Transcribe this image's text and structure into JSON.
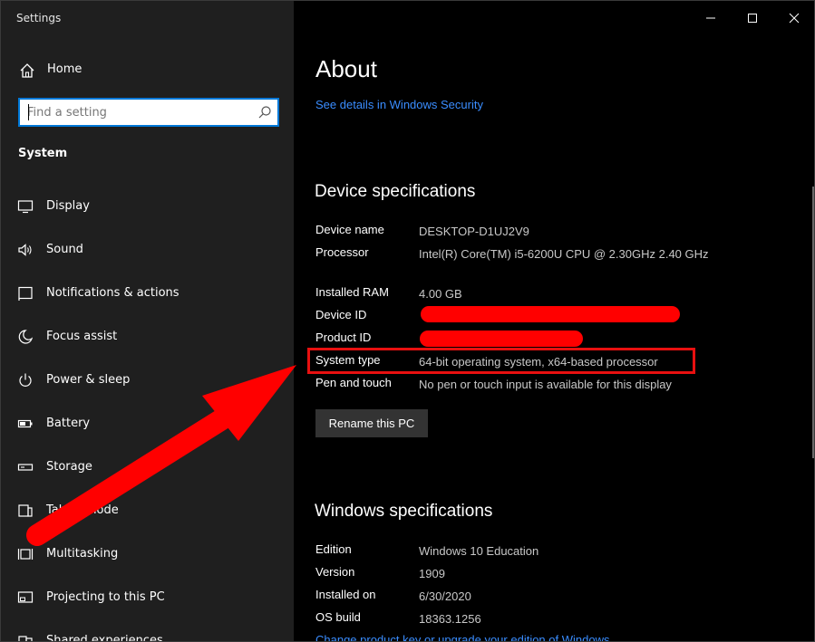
{
  "window": {
    "title": "Settings",
    "controls": {
      "minimize": "—",
      "maximize": "□",
      "close": "✕"
    }
  },
  "sidebar": {
    "home_label": "Home",
    "home_icon": "home-icon",
    "search_placeholder": "Find a setting",
    "search_icon": "search-icon",
    "section": "System",
    "items": [
      {
        "label": "Display",
        "icon": "display-icon"
      },
      {
        "label": "Sound",
        "icon": "sound-icon"
      },
      {
        "label": "Notifications & actions",
        "icon": "notifications-icon"
      },
      {
        "label": "Focus assist",
        "icon": "focus-assist-icon"
      },
      {
        "label": "Power & sleep",
        "icon": "power-icon"
      },
      {
        "label": "Battery",
        "icon": "battery-icon"
      },
      {
        "label": "Storage",
        "icon": "storage-icon"
      },
      {
        "label": "Tablet mode",
        "icon": "tablet-mode-icon"
      },
      {
        "label": "Multitasking",
        "icon": "multitasking-icon"
      },
      {
        "label": "Projecting to this PC",
        "icon": "projecting-icon"
      },
      {
        "label": "Shared experiences",
        "icon": "shared-experiences-icon"
      }
    ]
  },
  "main": {
    "title": "About",
    "security_link": "See details in Windows Security",
    "device_heading": "Device specifications",
    "device_specs": [
      {
        "key": "Device name",
        "value": "DESKTOP-D1UJ2V9"
      },
      {
        "key": "Processor",
        "value": "Intel(R) Core(TM) i5-6200U CPU @ 2.30GHz   2.40 GHz"
      },
      {
        "key": "Installed RAM",
        "value": "4.00 GB"
      },
      {
        "key": "Device ID",
        "value": ""
      },
      {
        "key": "Product ID",
        "value": ""
      },
      {
        "key": "System type",
        "value": "64-bit operating system, x64-based processor"
      },
      {
        "key": "Pen and touch",
        "value": "No pen or touch input is available for this display"
      }
    ],
    "rename_button": "Rename this PC",
    "windows_heading": "Windows specifications",
    "windows_specs": [
      {
        "key": "Edition",
        "value": "Windows 10 Education"
      },
      {
        "key": "Version",
        "value": "1909"
      },
      {
        "key": "Installed on",
        "value": "6/30/2020"
      },
      {
        "key": "OS build",
        "value": "18363.1256"
      }
    ],
    "change_key_link": "Change product key or upgrade your edition of Windows"
  },
  "colors": {
    "sidebar_bg": "#1f1f1f",
    "main_bg": "#000000",
    "accent": "#0078d7",
    "link": "#3a8dff",
    "annotation_red": "#ff0000"
  }
}
